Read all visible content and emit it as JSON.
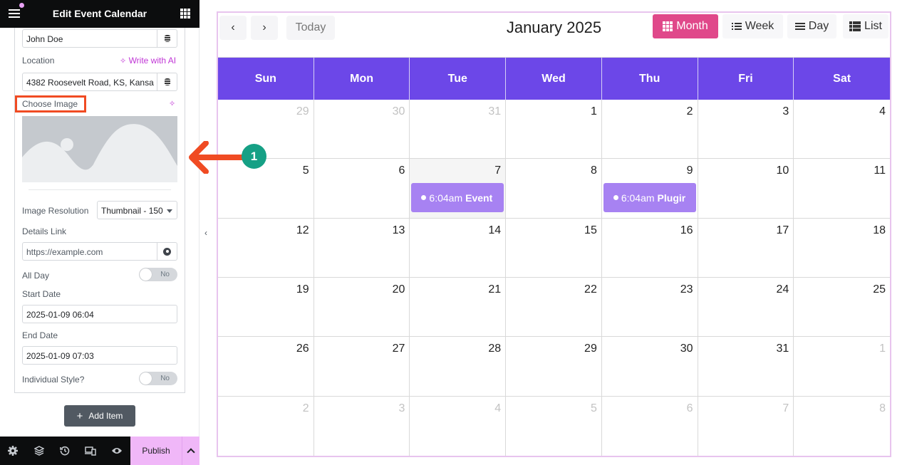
{
  "panel": {
    "title": "Edit Event Calendar",
    "organizer_value": "John Doe",
    "location_label": "Location",
    "write_with_ai": "Write with AI",
    "location_value": "4382 Roosevelt Road, KS, Kansa",
    "choose_image_label": "Choose Image",
    "image_resolution_label": "Image Resolution",
    "image_resolution_value": "Thumbnail - 150",
    "details_link_label": "Details Link",
    "details_link_placeholder": "https://example.com",
    "all_day_label": "All Day",
    "all_day_value": "No",
    "start_date_label": "Start Date",
    "start_date_value": "2025-01-09 06:04",
    "end_date_label": "End Date",
    "end_date_value": "2025-01-09 07:03",
    "individual_style_label": "Individual Style?",
    "individual_style_value": "No",
    "add_item_label": "Add Item",
    "publish_label": "Publish"
  },
  "calendar": {
    "title": "January 2025",
    "today_label": "Today",
    "prev_icon": "‹",
    "next_icon": "›",
    "views": [
      {
        "label": "Month",
        "icon": "grid",
        "active": true
      },
      {
        "label": "Week",
        "icon": "bullet-list",
        "active": false
      },
      {
        "label": "Day",
        "icon": "lines",
        "active": false
      },
      {
        "label": "List",
        "icon": "list",
        "active": false
      }
    ],
    "day_headers": [
      "Sun",
      "Mon",
      "Tue",
      "Wed",
      "Thu",
      "Fri",
      "Sat"
    ],
    "weeks": [
      [
        {
          "d": "29",
          "other": true
        },
        {
          "d": "30",
          "other": true
        },
        {
          "d": "31",
          "other": true
        },
        {
          "d": "1"
        },
        {
          "d": "2"
        },
        {
          "d": "3"
        },
        {
          "d": "4"
        }
      ],
      [
        {
          "d": "5"
        },
        {
          "d": "6"
        },
        {
          "d": "7",
          "today": true,
          "event": {
            "time": "6:04am",
            "title": "Event"
          }
        },
        {
          "d": "8"
        },
        {
          "d": "9",
          "event": {
            "time": "6:04am",
            "title": "Plugir"
          }
        },
        {
          "d": "10"
        },
        {
          "d": "11"
        }
      ],
      [
        {
          "d": "12"
        },
        {
          "d": "13"
        },
        {
          "d": "14"
        },
        {
          "d": "15"
        },
        {
          "d": "16"
        },
        {
          "d": "17"
        },
        {
          "d": "18"
        }
      ],
      [
        {
          "d": "19"
        },
        {
          "d": "20"
        },
        {
          "d": "21"
        },
        {
          "d": "22"
        },
        {
          "d": "23"
        },
        {
          "d": "24"
        },
        {
          "d": "25"
        }
      ],
      [
        {
          "d": "26"
        },
        {
          "d": "27"
        },
        {
          "d": "28"
        },
        {
          "d": "29"
        },
        {
          "d": "30"
        },
        {
          "d": "31"
        },
        {
          "d": "1",
          "other": true
        }
      ],
      [
        {
          "d": "2",
          "other": true
        },
        {
          "d": "3",
          "other": true
        },
        {
          "d": "4",
          "other": true
        },
        {
          "d": "5",
          "other": true
        },
        {
          "d": "6",
          "other": true
        },
        {
          "d": "7",
          "other": true
        },
        {
          "d": "8",
          "other": true
        }
      ]
    ],
    "colors": {
      "header": "#6c47e8",
      "event": "#a782f2",
      "active_view": "#e0488a",
      "border": "#e8c4ee"
    }
  },
  "annotation": {
    "step": "1"
  }
}
